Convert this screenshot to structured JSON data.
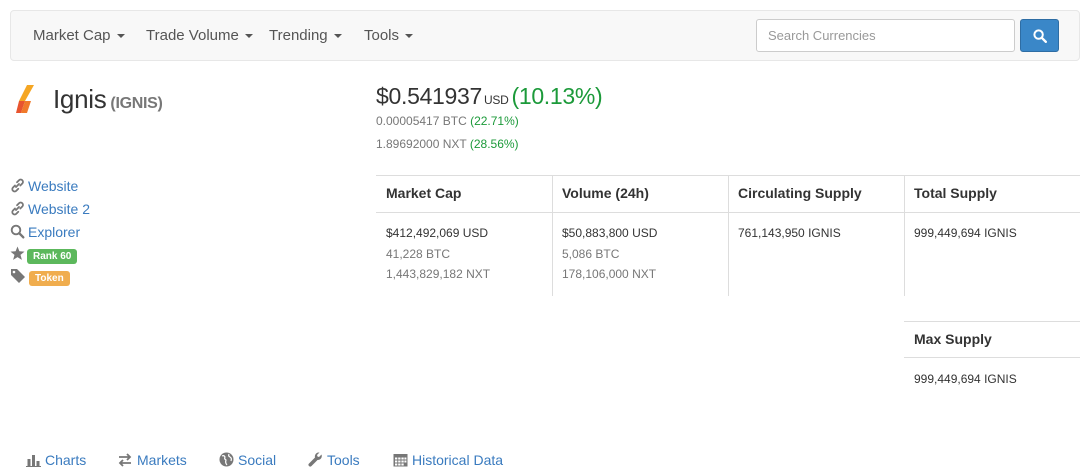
{
  "navbar": {
    "items": [
      {
        "label": "Market Cap"
      },
      {
        "label": "Trade Volume"
      },
      {
        "label": "Trending"
      },
      {
        "label": "Tools"
      }
    ],
    "search_placeholder": "Search Currencies"
  },
  "coin": {
    "name": "Ignis",
    "symbol": "(IGNIS)",
    "price": "$0.541937",
    "currency": "USD",
    "change": "(10.13%)",
    "btc_price": "0.00005417 BTC",
    "btc_change": "(22.71%)",
    "nxt_price": "1.89692000 NXT",
    "nxt_change": "(28.56%)"
  },
  "links": {
    "website": "Website",
    "website2": "Website 2",
    "explorer": "Explorer",
    "rank": "Rank 60",
    "token": "Token"
  },
  "stats": {
    "market_cap": {
      "label": "Market Cap",
      "usd": "$412,492,069 USD",
      "btc": "41,228 BTC",
      "nxt": "1,443,829,182 NXT"
    },
    "volume": {
      "label": "Volume (24h)",
      "usd": "$50,883,800 USD",
      "btc": "5,086 BTC",
      "nxt": "178,106,000 NXT"
    },
    "circulating": {
      "label": "Circulating Supply",
      "value": "761,143,950 IGNIS"
    },
    "total": {
      "label": "Total Supply",
      "value": "999,449,694 IGNIS"
    },
    "max": {
      "label": "Max Supply",
      "value": "999,449,694 IGNIS"
    }
  },
  "tabs": [
    {
      "label": "Charts"
    },
    {
      "label": "Markets"
    },
    {
      "label": "Social"
    },
    {
      "label": "Tools"
    },
    {
      "label": "Historical Data"
    }
  ],
  "colors": {
    "link": "#3a7bbf",
    "positive": "#1c9a3a",
    "button": "#3a87c8"
  }
}
